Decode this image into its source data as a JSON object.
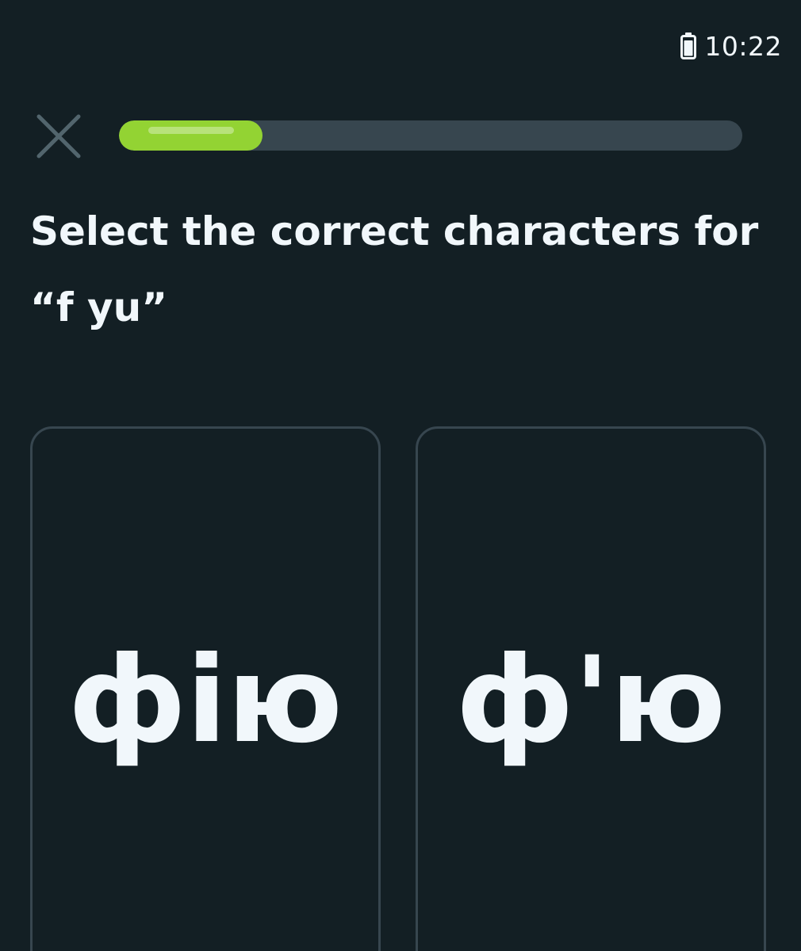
{
  "status_bar": {
    "time": "10:22",
    "battery_icon": "battery-icon"
  },
  "header": {
    "close_icon": "close-icon",
    "progress": 0.23,
    "progress_color": "#93d333",
    "track_color": "#37464f"
  },
  "prompt": {
    "text": "Select the correct characters for “f yu”"
  },
  "choices": [
    {
      "text": "фію"
    },
    {
      "text": "ф'ю"
    }
  ]
}
